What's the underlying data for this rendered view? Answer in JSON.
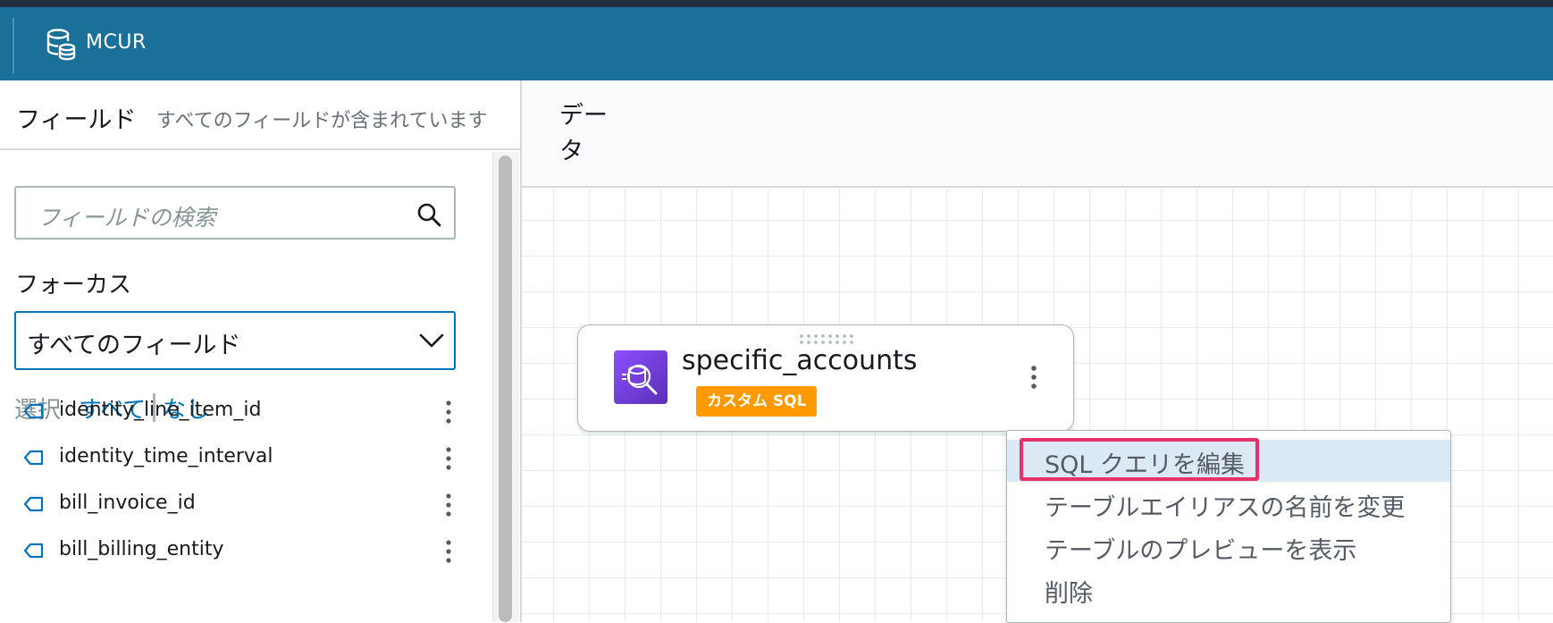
{
  "header": {
    "title": "MCUR",
    "icon": "database-icon"
  },
  "fields_panel": {
    "heading": "フィールド",
    "subtitle": "すべてのフィールドが含まれています",
    "search": {
      "placeholder": "フィールドの検索",
      "icon": "search-icon"
    },
    "focus": {
      "label": "フォーカス",
      "selected": "すべてのフィールド"
    },
    "select_row": {
      "label": "選択",
      "all": "すべて",
      "none": "なし"
    },
    "fields": [
      {
        "name": "identity_line_item_id"
      },
      {
        "name": "identity_time_interval"
      },
      {
        "name": "bill_invoice_id"
      },
      {
        "name": "bill_billing_entity"
      }
    ]
  },
  "data_panel": {
    "heading": "データ",
    "node": {
      "name": "specific_accounts",
      "badge": "カスタム SQL",
      "badge_color": "#ff9900"
    },
    "context_menu": {
      "items": [
        {
          "label": "SQL クエリを編集"
        },
        {
          "label": "テーブルエイリアスの名前を変更"
        },
        {
          "label": "テーブルのプレビューを表示"
        },
        {
          "label": "削除"
        }
      ],
      "highlight_color": "#e8316b"
    }
  },
  "colors": {
    "header_bg": "#1a7098",
    "accent": "#0073bb"
  }
}
